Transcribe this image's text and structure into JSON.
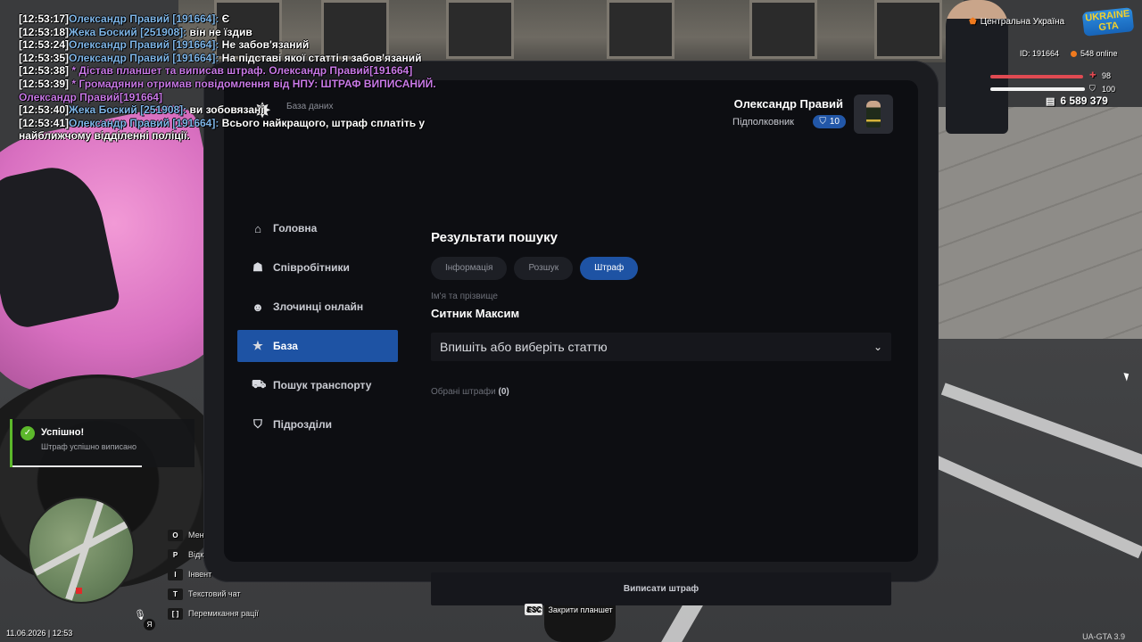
{
  "chat": [
    {
      "ts": "[12:53:17]",
      "name": "Олександр Правий [191664]:",
      "text": " Є",
      "type": "say"
    },
    {
      "ts": "[12:53:18]",
      "name": "Жека Боский [251908]:",
      "text": " він не їздив",
      "type": "say"
    },
    {
      "ts": "[12:53:24]",
      "name": "Олександр Правий [191664]:",
      "text": " Не забов'язаний",
      "type": "say"
    },
    {
      "ts": "[12:53:35]",
      "name": "Олександр Правий [191664]:",
      "text": " На підставі якої статті я забов'язаний",
      "type": "say"
    },
    {
      "ts": "[12:53:38]",
      "name": "",
      "text": " * Дістав планшет та виписав штраф. Олександр Правий[191664]",
      "type": "rp"
    },
    {
      "ts": "[12:53:39]",
      "name": "",
      "text": " * Громадянин отримав повідомлення від НПУ: ШТРАФ ВИПИСАНИЙ. Олександр Правий[191664]",
      "type": "rp"
    },
    {
      "ts": "[12:53:40]",
      "name": "Жека Боский [251908]:",
      "text": " ви зобовязані",
      "type": "say"
    },
    {
      "ts": "[12:53:41]",
      "name": "Олександр Правий [191664]:",
      "text": " Всього найкращого, штраф сплатіть у найближчому відділенні поліції.",
      "type": "say"
    }
  ],
  "hud": {
    "region": "Центральна Україна",
    "logo_top": "UKRAINE",
    "logo_bottom": "GTA",
    "id": "ID: 191664",
    "online": "548 online",
    "health": "98",
    "armor": "100",
    "health_fraction": 0.98,
    "armor_fraction": 1.0,
    "money": "6 589 379"
  },
  "tablet": {
    "subtitle": "База даних",
    "user_name": "Олександр Правий",
    "rank": "Підполковник",
    "badge": "10",
    "nav": [
      {
        "id": "home",
        "label": "Головна",
        "icon": "home-icon",
        "glyph": "⌂",
        "active": false
      },
      {
        "id": "employees",
        "label": "Співробітники",
        "icon": "people-icon",
        "glyph": "☗",
        "active": false
      },
      {
        "id": "criminals",
        "label": "Злочинці онлайн",
        "icon": "mask-icon",
        "glyph": "☻",
        "active": false
      },
      {
        "id": "base",
        "label": "База",
        "icon": "star-icon",
        "glyph": "★",
        "active": true
      },
      {
        "id": "vehicle",
        "label": "Пошук транспорту",
        "icon": "car-icon",
        "glyph": "⛟",
        "active": false
      },
      {
        "id": "units",
        "label": "Підрозділи",
        "icon": "shield-icon",
        "glyph": "⛉",
        "active": false
      }
    ],
    "content": {
      "title": "Результати пошуку",
      "tabs": [
        {
          "label": "Інформація",
          "active": false
        },
        {
          "label": "Розшук",
          "active": false
        },
        {
          "label": "Штраф",
          "active": true
        }
      ],
      "name_label": "Ім'я та прізвище",
      "person": "Ситник Максим",
      "article_placeholder": "Впишіть або виберіть статтю",
      "selected_label": "Обрані штрафи",
      "selected_count": "(0)",
      "issue_button": "Виписати штраф"
    }
  },
  "notification": {
    "title": "Успішно!",
    "text": "Штраф успішно виписано"
  },
  "keys": [
    {
      "key": "O",
      "label": "Мен"
    },
    {
      "key": "P",
      "label": "Відк"
    },
    {
      "key": "I",
      "label": "Інвент"
    },
    {
      "key": "T",
      "label": "Текстовий чат"
    },
    {
      "key": "[ ]",
      "label": "Перемикання рації"
    }
  ],
  "esc": {
    "key": "ESC",
    "label": "Закрити планшет"
  },
  "language": "Я",
  "clock": "11.06.2026 | 12:53",
  "version": "UA-GTA 3.9",
  "colors": {
    "accent": "#1e53a4",
    "success": "#5cb82b",
    "chat_name": "#7fb6e8",
    "chat_rp": "#c879e6"
  }
}
